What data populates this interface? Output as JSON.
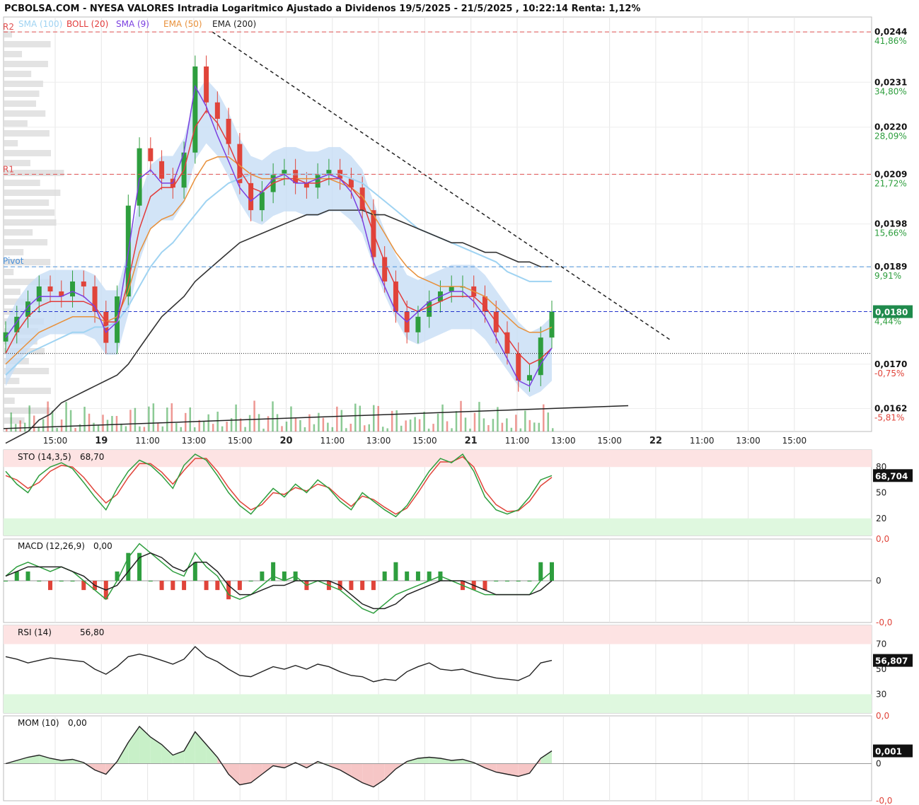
{
  "header": {
    "title": "PCBOLSA.COM - NYESA VALORES Intradia Logaritmico Ajustado a Dividenos 19/5/2025 - 21/5/2025 , 10:22:14 Renta: 1,12%"
  },
  "legend": {
    "sma100": "SMA (100)",
    "boll": "BOLL (20)",
    "sma9": "SMA (9)",
    "ema50": "EMA (50)",
    "ema200": "EMA (200)"
  },
  "colors": {
    "up": "#2e9e3e",
    "down": "#e0443a",
    "sma100": "#9fd3f2",
    "boll": "#e23b3b",
    "sma9": "#7a3fe0",
    "ema50": "#e8903a",
    "ema200": "#333333",
    "band": "#c7ddf5",
    "price_tag": "#1f8a4c",
    "r_line": "#e05050",
    "pivot_line": "#4a90d9",
    "pct_pos": "#2e9e3e",
    "pct_neg": "#e0443a",
    "ob_zone": "#fde3e3",
    "os_zone": "#dff8df"
  },
  "levels": {
    "r2": "R2",
    "r1": "R1",
    "pivot": "Pivot"
  },
  "chart_data": [
    {
      "type": "candlestick",
      "scale": "log",
      "ylim": [
        0.0158,
        0.0248
      ],
      "y_ticks": [
        {
          "value": 0.0244,
          "label": "0,0244",
          "pct": "41,86%"
        },
        {
          "value": 0.0231,
          "label": "0,0231",
          "pct": "34,80%"
        },
        {
          "value": 0.022,
          "label": "0,0220",
          "pct": "28,09%"
        },
        {
          "value": 0.0209,
          "label": "0,0209",
          "pct": "21,72%"
        },
        {
          "value": 0.0198,
          "label": "0,0198",
          "pct": "15,66%"
        },
        {
          "value": 0.0189,
          "label": "0,0189",
          "pct": "9,91%"
        },
        {
          "value": 0.017,
          "label": "0,0170",
          "pct": "-0,75%"
        },
        {
          "value": 0.0162,
          "label": "0,0162",
          "pct": "-5,81%"
        }
      ],
      "x_labels": [
        "15:00",
        "19",
        "11:00",
        "13:00",
        "15:00",
        "20",
        "11:00",
        "13:00",
        "15:00",
        "21",
        "11:00",
        "13:00",
        "15:00",
        "22",
        "11:00",
        "13:00",
        "15:00"
      ],
      "bold_x_labels": [
        "19",
        "20",
        "21",
        "22"
      ],
      "last_price": 0.018,
      "last_price_label": "0,0180",
      "last_pct": "4,44%",
      "r2": 0.0244,
      "r1": 0.0209,
      "pivot": 0.0189,
      "base_ref": 0.0172,
      "close": [
        0.0176,
        0.0179,
        0.0182,
        0.0185,
        0.0184,
        0.0183,
        0.0186,
        0.0185,
        0.018,
        0.0174,
        0.0183,
        0.0202,
        0.0215,
        0.0212,
        0.0208,
        0.0206,
        0.0214,
        0.0235,
        0.0226,
        0.0222,
        0.0216,
        0.0207,
        0.0201,
        0.0205,
        0.0209,
        0.021,
        0.0207,
        0.0206,
        0.0209,
        0.021,
        0.0208,
        0.0206,
        0.0201,
        0.0191,
        0.0186,
        0.018,
        0.0176,
        0.0179,
        0.0182,
        0.0184,
        0.0185,
        0.0185,
        0.0183,
        0.018,
        0.0176,
        0.0172,
        0.0167,
        0.0168,
        0.0175,
        0.018
      ],
      "sma9": [
        0.0175,
        0.0178,
        0.0181,
        0.0183,
        0.0183,
        0.0183,
        0.0184,
        0.0183,
        0.0181,
        0.0176,
        0.0178,
        0.0192,
        0.0208,
        0.021,
        0.0207,
        0.0207,
        0.0214,
        0.023,
        0.0225,
        0.0218,
        0.0212,
        0.0206,
        0.0203,
        0.0205,
        0.0208,
        0.0209,
        0.0207,
        0.0207,
        0.0208,
        0.0209,
        0.0208,
        0.0205,
        0.0199,
        0.019,
        0.0185,
        0.018,
        0.0178,
        0.018,
        0.0182,
        0.0183,
        0.0184,
        0.0184,
        0.0182,
        0.0179,
        0.0175,
        0.0171,
        0.0167,
        0.0166,
        0.017,
        0.0173
      ],
      "boll_mid": [
        0.0172,
        0.0176,
        0.0179,
        0.0181,
        0.0182,
        0.0182,
        0.0182,
        0.0182,
        0.0181,
        0.0178,
        0.0178,
        0.0186,
        0.0197,
        0.0204,
        0.0206,
        0.0206,
        0.021,
        0.022,
        0.0224,
        0.0221,
        0.0216,
        0.021,
        0.0206,
        0.0205,
        0.0207,
        0.0208,
        0.0208,
        0.0207,
        0.0207,
        0.0208,
        0.0208,
        0.0206,
        0.0203,
        0.0196,
        0.019,
        0.0185,
        0.0181,
        0.018,
        0.0181,
        0.0182,
        0.0183,
        0.0183,
        0.0183,
        0.0181,
        0.0178,
        0.0175,
        0.0172,
        0.017,
        0.0171,
        0.0173
      ],
      "ema50": [
        0.017,
        0.0172,
        0.0174,
        0.0176,
        0.0177,
        0.0178,
        0.0179,
        0.0179,
        0.0179,
        0.0178,
        0.0179,
        0.0184,
        0.0192,
        0.0197,
        0.0199,
        0.02,
        0.0203,
        0.0208,
        0.0212,
        0.0213,
        0.0213,
        0.0211,
        0.0209,
        0.0208,
        0.0208,
        0.0208,
        0.0208,
        0.0208,
        0.0208,
        0.0208,
        0.0207,
        0.0206,
        0.0204,
        0.02,
        0.0196,
        0.0192,
        0.0189,
        0.0187,
        0.0186,
        0.0185,
        0.0185,
        0.0185,
        0.0184,
        0.0183,
        0.0181,
        0.0179,
        0.0177,
        0.0176,
        0.0176,
        0.0177
      ],
      "sma100": [
        0.0168,
        0.017,
        0.0172,
        0.0173,
        0.0174,
        0.0175,
        0.0176,
        0.0176,
        0.0177,
        0.0177,
        0.0178,
        0.0181,
        0.0185,
        0.0189,
        0.0192,
        0.0194,
        0.0197,
        0.02,
        0.0203,
        0.0205,
        0.0207,
        0.0208,
        0.0209,
        0.0209,
        0.0209,
        0.0209,
        0.0209,
        0.0209,
        0.0209,
        0.0209,
        0.0209,
        0.0208,
        0.0207,
        0.0205,
        0.0203,
        0.0201,
        0.0199,
        0.0197,
        0.0196,
        0.0195,
        0.0194,
        0.0193,
        0.0192,
        0.0191,
        0.019,
        0.0188,
        0.0187,
        0.0186,
        0.0186,
        0.0186
      ],
      "ema200": [
        0.0156,
        0.0157,
        0.0158,
        0.016,
        0.0161,
        0.0163,
        0.0164,
        0.0165,
        0.0166,
        0.0167,
        0.0168,
        0.017,
        0.0173,
        0.0176,
        0.0179,
        0.0181,
        0.0183,
        0.0186,
        0.0188,
        0.019,
        0.0192,
        0.0194,
        0.0195,
        0.0196,
        0.0197,
        0.0198,
        0.0199,
        0.02,
        0.02,
        0.0201,
        0.0201,
        0.0201,
        0.0201,
        0.02,
        0.02,
        0.0199,
        0.0198,
        0.0197,
        0.0196,
        0.0195,
        0.0194,
        0.0194,
        0.0193,
        0.0192,
        0.0192,
        0.0191,
        0.019,
        0.019,
        0.0189,
        0.0189
      ],
      "volume_max": 100
    },
    {
      "type": "line",
      "name": "STO (14,3,5)",
      "label": "STO (14,3,5)",
      "value_label": "68,70",
      "last_tag": "68,704",
      "ylim": [
        0,
        100
      ],
      "ticks": [
        {
          "value": 80,
          "label": "80"
        },
        {
          "value": 50,
          "label": "50"
        },
        {
          "value": 20,
          "label": "20"
        }
      ],
      "overbought": 80,
      "oversold": 20,
      "k": [
        75,
        60,
        50,
        70,
        80,
        85,
        78,
        62,
        45,
        30,
        55,
        75,
        88,
        82,
        70,
        55,
        82,
        95,
        88,
        70,
        50,
        35,
        25,
        40,
        55,
        45,
        60,
        50,
        65,
        55,
        40,
        30,
        50,
        40,
        30,
        22,
        35,
        55,
        75,
        90,
        85,
        95,
        75,
        45,
        30,
        25,
        30,
        45,
        65,
        70
      ],
      "d": [
        70,
        65,
        55,
        62,
        75,
        82,
        80,
        68,
        52,
        38,
        48,
        68,
        84,
        84,
        74,
        60,
        76,
        90,
        90,
        75,
        56,
        40,
        30,
        36,
        50,
        48,
        56,
        52,
        60,
        56,
        44,
        34,
        46,
        42,
        33,
        25,
        32,
        50,
        70,
        86,
        86,
        92,
        80,
        52,
        36,
        28,
        29,
        40,
        58,
        68
      ]
    },
    {
      "type": "line",
      "name": "MACD (12,26,9)",
      "label": "MACD (12,26,9)",
      "value_label": "0,00",
      "ylim": [
        -0.0009,
        0.0009
      ],
      "ticks": [
        {
          "value": 0.0009,
          "label": "0,0"
        },
        {
          "value": 0,
          "label": "0"
        },
        {
          "value": -0.0009,
          "label": "-0,0"
        }
      ],
      "macd": [
        0.0001,
        0.0003,
        0.0004,
        0.0003,
        0.0002,
        0.0003,
        0.0002,
        0.0,
        -0.0002,
        -0.0004,
        0.0,
        0.0005,
        0.0008,
        0.0006,
        0.0004,
        0.0002,
        0.0001,
        0.0006,
        0.0003,
        0.0001,
        -0.0003,
        -0.0004,
        -0.0003,
        -0.0001,
        0.0001,
        0.0,
        0.0001,
        -0.0001,
        0.0,
        -0.0001,
        -0.0002,
        -0.0004,
        -0.0006,
        -0.0007,
        -0.0005,
        -0.0003,
        -0.0002,
        -0.0001,
        0.0,
        0.0001,
        0.0,
        -0.0001,
        -0.0002,
        -0.0003,
        -0.0003,
        -0.0003,
        -0.0003,
        -0.0003,
        0.0,
        0.0002
      ],
      "signal": [
        0.0001,
        0.0002,
        0.0003,
        0.0003,
        0.0003,
        0.0003,
        0.0002,
        0.0001,
        -0.0001,
        -0.0002,
        -0.0001,
        0.0002,
        0.0005,
        0.0006,
        0.0005,
        0.0003,
        0.0002,
        0.0004,
        0.0004,
        0.0002,
        -0.0001,
        -0.0003,
        -0.0003,
        -0.0002,
        -0.0001,
        -0.0001,
        0.0,
        0.0,
        0.0,
        0.0,
        -0.0001,
        -0.0003,
        -0.0005,
        -0.0006,
        -0.0006,
        -0.0005,
        -0.0003,
        -0.0002,
        -0.0001,
        0.0,
        0.0,
        0.0,
        -0.0001,
        -0.0002,
        -0.0003,
        -0.0003,
        -0.0003,
        -0.0003,
        -0.0002,
        0.0
      ]
    },
    {
      "type": "line",
      "name": "RSI (14)",
      "label": "RSI (14)",
      "value_label": "56,80",
      "last_tag": "56,807",
      "ylim": [
        15,
        85
      ],
      "ticks": [
        {
          "value": 70,
          "label": "70"
        },
        {
          "value": 50,
          "label": "50"
        },
        {
          "value": 30,
          "label": "30"
        }
      ],
      "overbought": 70,
      "oversold": 30,
      "rsi": [
        60,
        58,
        55,
        57,
        59,
        58,
        57,
        56,
        50,
        46,
        52,
        60,
        62,
        60,
        57,
        54,
        58,
        68,
        60,
        56,
        50,
        45,
        44,
        48,
        52,
        50,
        53,
        50,
        54,
        52,
        48,
        45,
        44,
        40,
        42,
        41,
        48,
        52,
        55,
        50,
        49,
        50,
        47,
        45,
        43,
        42,
        41,
        45,
        55,
        57
      ]
    },
    {
      "type": "line",
      "name": "MOM (10)",
      "label": "MOM (10)",
      "value_label": "0,00",
      "last_tag": "0,001",
      "ylim": [
        -0.0035,
        0.0045
      ],
      "ticks": [
        {
          "value": 0.0045,
          "label": "0,0"
        },
        {
          "value": 0,
          "label": "0"
        },
        {
          "value": -0.0035,
          "label": "-0,0"
        }
      ],
      "mom": [
        0.0,
        0.0003,
        0.0006,
        0.0008,
        0.0005,
        0.0003,
        0.0004,
        0.0001,
        -0.0006,
        -0.001,
        0.0002,
        0.002,
        0.0035,
        0.0025,
        0.0018,
        0.0008,
        0.0012,
        0.003,
        0.0018,
        0.0006,
        -0.001,
        -0.002,
        -0.0018,
        -0.001,
        -0.0002,
        -0.0004,
        0.0001,
        -0.0004,
        0.0002,
        -0.0002,
        -0.0006,
        -0.0012,
        -0.0018,
        -0.0022,
        -0.0015,
        -0.0005,
        0.0002,
        0.0005,
        0.0006,
        0.0005,
        0.0003,
        0.0004,
        0.0001,
        -0.0004,
        -0.0008,
        -0.001,
        -0.0012,
        -0.0009,
        0.0005,
        0.0012
      ]
    }
  ]
}
